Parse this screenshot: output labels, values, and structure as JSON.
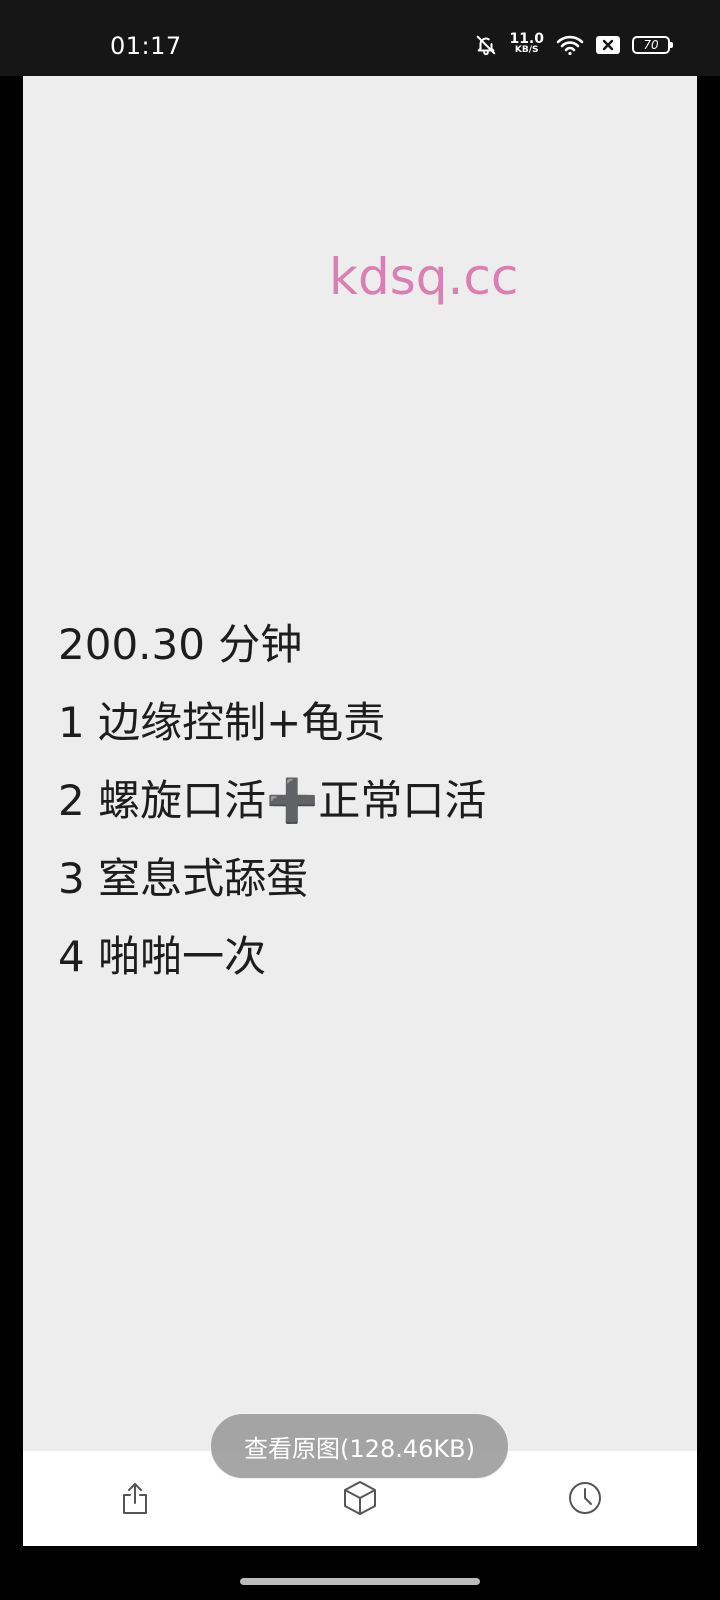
{
  "status_bar": {
    "time": "01:17",
    "net_speed_value": "11.0",
    "net_speed_unit": "KB/S",
    "battery_level": "70",
    "icons": [
      "bell-muted-icon",
      "wifi-icon",
      "sim-blocked-icon",
      "battery-icon"
    ]
  },
  "image": {
    "watermark": "kdsq.cc",
    "lines": [
      "200.30 分钟",
      "1 边缘控制+龟责",
      "2 螺旋口活➕正常口活",
      "3 窒息式舔蛋",
      "4 啪啪一次"
    ]
  },
  "view_original_button": "查看原图(128.46KB)",
  "toolbar": {
    "icons": [
      "share-icon",
      "cube-icon",
      "clock-icon"
    ]
  }
}
